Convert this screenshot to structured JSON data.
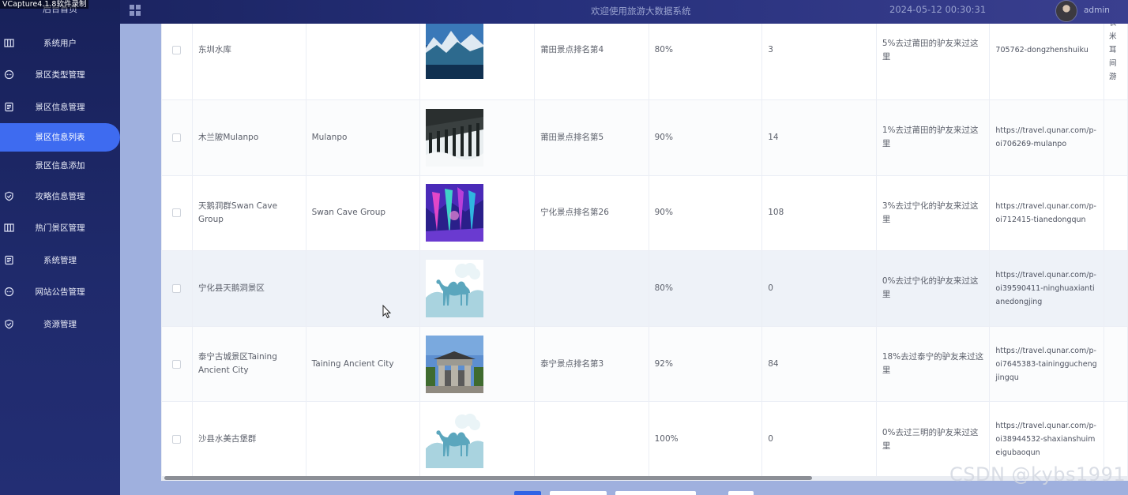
{
  "watermark_recorder": "VCapture4.1.8软件录制",
  "sidebar": {
    "brand": "后台首页",
    "items": [
      {
        "label": "系统用户",
        "icon": "columns-icon"
      },
      {
        "label": "景区类型管理",
        "icon": "chat-icon"
      },
      {
        "label": "景区信息管理",
        "icon": "document-icon"
      },
      {
        "label": "景区信息列表",
        "sub": true,
        "active": true
      },
      {
        "label": "景区信息添加",
        "sub": true
      },
      {
        "label": "攻略信息管理",
        "icon": "shield-icon"
      },
      {
        "label": "热门景区管理",
        "icon": "columns-icon"
      },
      {
        "label": "系统管理",
        "icon": "document-icon"
      },
      {
        "label": "网站公告管理",
        "icon": "chat-icon"
      },
      {
        "label": "资源管理",
        "icon": "shield-icon"
      }
    ]
  },
  "header": {
    "title": "欢迎使用旅游大数据系统",
    "datetime": "2024-05-12 00:30:31",
    "user": "admin"
  },
  "table": {
    "rows": [
      {
        "name": "东圳水库",
        "en": "",
        "image": "lake",
        "rank": "莆田景点排名第4",
        "rate": "80%",
        "count": "3",
        "visited": "5%去过莆田的驴友来过这里",
        "url": "705762-dongzhenshuiku",
        "extra": "长\n米\n耳\n间\n游"
      },
      {
        "name": "木兰陂Mulanpo",
        "en": "Mulanpo",
        "image": "dam",
        "rank": "莆田景点排名第5",
        "rate": "90%",
        "count": "14",
        "visited": "1%去过莆田的驴友来过这里",
        "url": "https://travel.qunar.com/p-oi706269-mulanpo",
        "extra": ""
      },
      {
        "name": "天鹅洞群Swan Cave Group",
        "en": "Swan Cave Group",
        "image": "cave",
        "rank": "宁化景点排名第26",
        "rate": "90%",
        "count": "108",
        "visited": "3%去过宁化的驴友来过这里",
        "url": "https://travel.qunar.com/p-oi712415-tianedongqun",
        "extra": ""
      },
      {
        "name": "宁化县天鹅洞景区",
        "en": "",
        "image": "camel",
        "rank": "",
        "rate": "80%",
        "count": "0",
        "visited": "0%去过宁化的驴友来过这里",
        "url": "https://travel.qunar.com/p-oi39590411-ninghuaxiantianedongjing",
        "extra": ""
      },
      {
        "name": "泰宁古城景区Taining Ancient City",
        "en": "Taining Ancient City",
        "image": "gate",
        "rank": "泰宁景点排名第3",
        "rate": "92%",
        "count": "84",
        "visited": "18%去过泰宁的驴友来过这里",
        "url": "https://travel.qunar.com/p-oi7645383-tainingguchengjingqu",
        "extra": ""
      },
      {
        "name": "沙县水美古堡群",
        "en": "",
        "image": "camel",
        "rank": "",
        "rate": "100%",
        "count": "0",
        "visited": "0%去过三明的驴友来过这里",
        "url": "https://travel.qunar.com/p-oi38944532-shaxianshuimeigubaoqun",
        "extra": ""
      }
    ]
  },
  "watermark_csdn": "CSDN @kybs1991"
}
